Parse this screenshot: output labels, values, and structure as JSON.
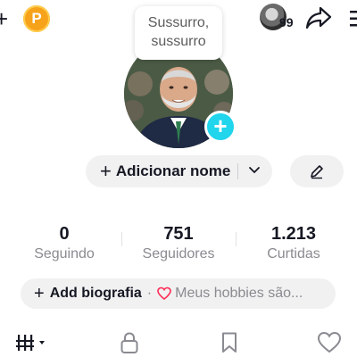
{
  "top": {
    "plus_glyph": "+",
    "coin_letter": "P",
    "notification_count": "99",
    "icons": [
      "add-icon",
      "coin-icon",
      "avatar",
      "share-icon",
      "more-icon"
    ]
  },
  "bubble": {
    "line1": "Sussurro,",
    "line2": "sussurro"
  },
  "profile": {
    "add_photo_glyph": "+",
    "add_name_label": "Adicionar nome",
    "plus_glyph": "+"
  },
  "stats": [
    {
      "value": "0",
      "label": "Seguindo"
    },
    {
      "value": "751",
      "label": "Seguidores"
    },
    {
      "value": "1.213",
      "label": "Curtidas"
    }
  ],
  "bio": {
    "plus_glyph": "+",
    "add_label": "Add biografia",
    "separator": "·",
    "hint": "Meus hobbies são..."
  },
  "tabs": [
    "videos-grid-icon",
    "lock-icon",
    "bookmark-icon",
    "heart-icon"
  ],
  "colors": {
    "coin": "#f7a21b",
    "add_photo": "#20d5ec",
    "heart_accent": "#fe2c55",
    "pill_bg": "#f1f1f2",
    "muted_text": "#8a8b91"
  }
}
